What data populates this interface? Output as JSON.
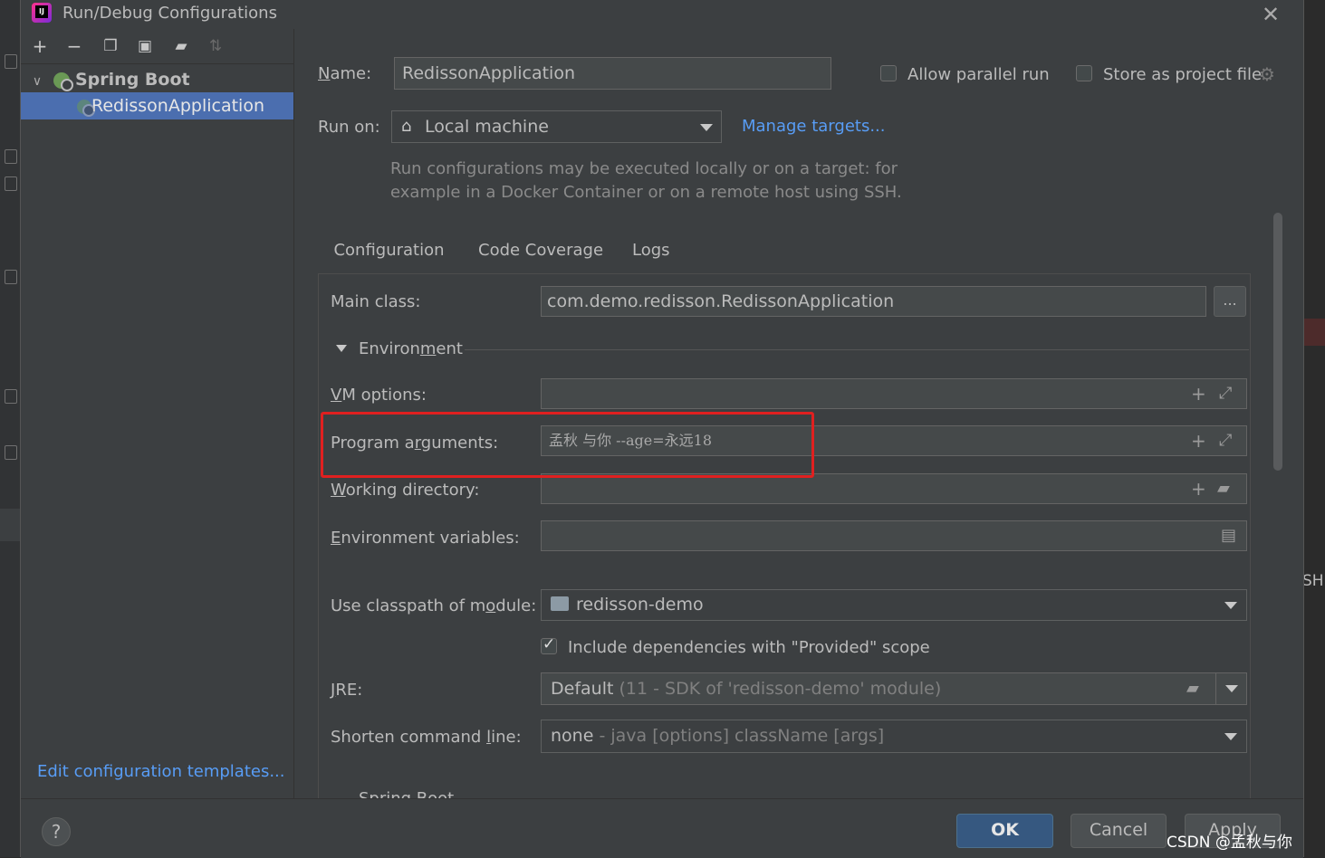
{
  "window": {
    "title": "Run/Debug Configurations"
  },
  "tree": {
    "group": "Spring Boot",
    "item": "RedissonApplication"
  },
  "left": {
    "edit_templates": "Edit configuration templates..."
  },
  "form": {
    "name_label": "Name:",
    "name_value": "RedissonApplication",
    "allow_parallel": "Allow parallel run",
    "store_project": "Store as project file",
    "run_on_label": "Run on:",
    "run_on_value": "Local machine",
    "manage_targets": "Manage targets...",
    "hint_line1": "Run configurations may be executed locally or on a target: for",
    "hint_line2": "example in a Docker Container or on a remote host using SSH."
  },
  "tabs": [
    "Configuration",
    "Code Coverage",
    "Logs"
  ],
  "config": {
    "main_class_label": "Main class:",
    "main_class_value": "com.demo.redisson.RedissonApplication",
    "browse": "...",
    "environment": "Environment",
    "vm_label": "VM options:",
    "vm_value": "",
    "program_args_label": "Program arguments:",
    "program_args_value": "孟秋 与你 --age=永远18",
    "working_dir_label": "Working directory:",
    "working_dir_value": "",
    "env_vars_label": "Environment variables:",
    "env_vars_value": "",
    "classpath_label": "Use classpath of module:",
    "classpath_value": "redisson-demo",
    "include_deps": "Include dependencies with \"Provided\" scope",
    "jre_label": "JRE:",
    "jre_value": "Default",
    "jre_detail": "(11 - SDK of 'redisson-demo' module)",
    "shorten_label": "Shorten command line:",
    "shorten_value": "none",
    "shorten_detail": "- java [options] className [args]",
    "next_section": "Spring Boot"
  },
  "buttons": {
    "ok": "OK",
    "cancel": "Cancel",
    "apply": "Apply",
    "help": "?"
  },
  "background": {
    "right_text": "SH"
  },
  "watermark": "CSDN @孟秋与你"
}
